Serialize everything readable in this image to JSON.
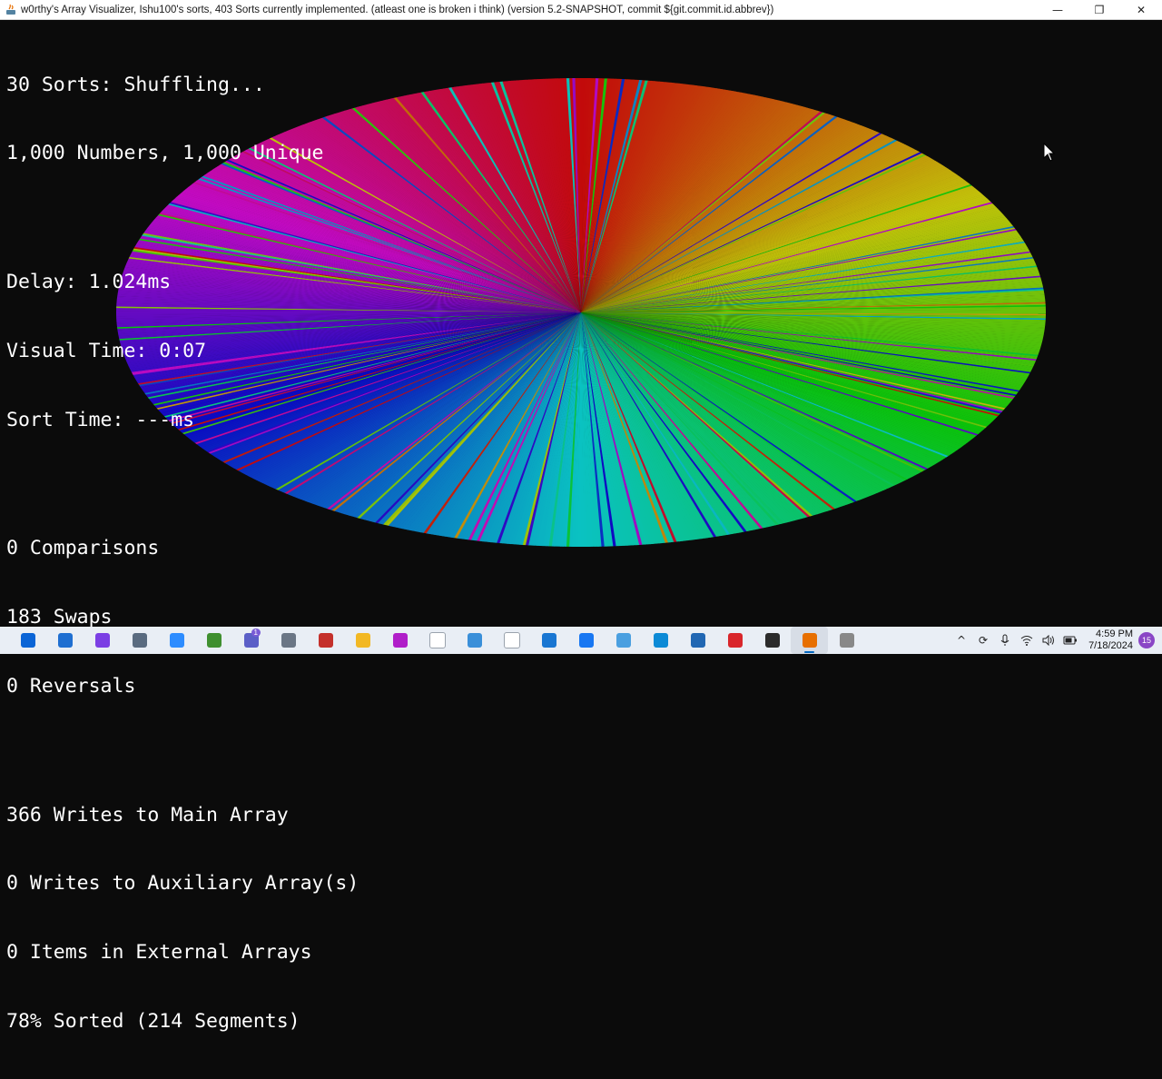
{
  "window": {
    "title": "w0rthy's Array Visualizer, Ishu100's sorts, 403 Sorts currently implemented. (atleast one is broken i think) (version 5.2-SNAPSHOT, commit ${git.commit.id.abbrev})",
    "minimize_glyph": "—",
    "restore_glyph": "❐",
    "close_glyph": "✕"
  },
  "stats": {
    "status": "30 Sorts: Shuffling...",
    "numbers": "1,000 Numbers, 1,000 Unique",
    "delay": "Delay: 1.024ms",
    "visual_time": "Visual Time: 0:07",
    "sort_time": "Sort Time: ---ms",
    "comparisons": "0 Comparisons",
    "swaps": "183 Swaps",
    "reversals": "0 Reversals",
    "main_writes": "366 Writes to Main Array",
    "aux_writes": "0 Writes to Auxiliary Array(s)",
    "external_items": "0 Items in External Arrays",
    "sorted": "78% Sorted (214 Segments)"
  },
  "visualization": {
    "type": "color-circle",
    "element_count": 1000,
    "sorted_fraction": 0.78
  },
  "taskbar": {
    "icons": [
      {
        "name": "start-icon",
        "color": "#0a64d6"
      },
      {
        "name": "mail-icon",
        "color": "#1f6fd1"
      },
      {
        "name": "messenger-icon",
        "color": "#7b3fe4"
      },
      {
        "name": "store-icon",
        "color": "#5a6b80"
      },
      {
        "name": "zoom-icon",
        "color": "#2d8cff"
      },
      {
        "name": "app-green-icon",
        "color": "#3f8f2f"
      },
      {
        "name": "teams-icon",
        "color": "#5b5fc7",
        "badge": "1"
      },
      {
        "name": "cloud-icon",
        "color": "#6b7685"
      },
      {
        "name": "document-red-icon",
        "color": "#c4302b"
      },
      {
        "name": "file-explorer-icon",
        "color": "#f2b824"
      },
      {
        "name": "purple-app-icon",
        "color": "#b01ec9"
      },
      {
        "name": "blank-file-icon",
        "color": "#ffffff"
      },
      {
        "name": "photos-icon",
        "color": "#3a8fd9"
      },
      {
        "name": "blank-file-2-icon",
        "color": "#ffffff"
      },
      {
        "name": "window-icon",
        "color": "#1976d2"
      },
      {
        "name": "facebook-icon",
        "color": "#1877f2"
      },
      {
        "name": "image-viewer-icon",
        "color": "#4a9fe0"
      },
      {
        "name": "edge-icon",
        "color": "#0c8ad6"
      },
      {
        "name": "globe-icon",
        "color": "#2167b3"
      },
      {
        "name": "acrobat-icon",
        "color": "#d9262b"
      },
      {
        "name": "terminal-icon",
        "color": "#2b2b2b"
      },
      {
        "name": "java-icon",
        "color": "#e76f00",
        "active": true
      },
      {
        "name": "chrome-icon",
        "color": "#888888"
      }
    ],
    "tray": {
      "chevron_glyph": "^",
      "clock_time": "4:59 PM",
      "clock_date": "7/18/2024",
      "notifications": "15"
    }
  }
}
